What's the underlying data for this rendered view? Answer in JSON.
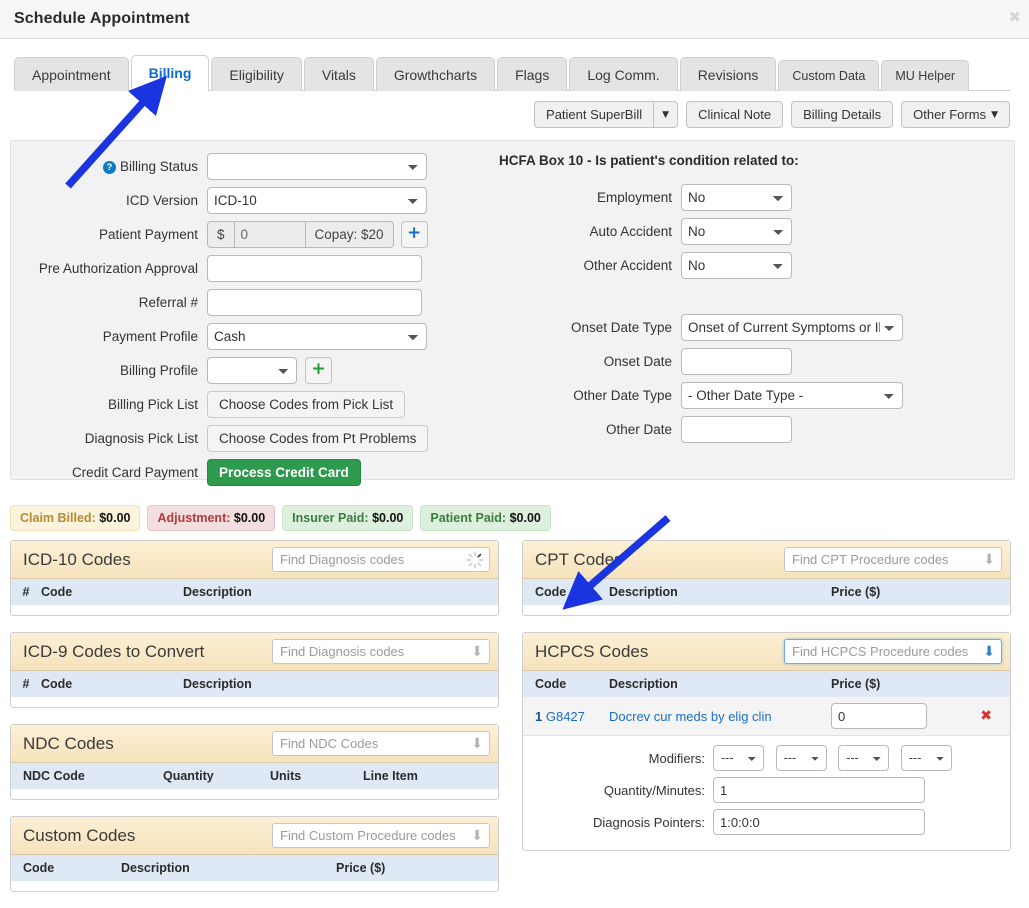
{
  "window": {
    "title": "Schedule Appointment",
    "close_icon": "close-icon"
  },
  "tabs": [
    {
      "label": "Appointment",
      "active": false
    },
    {
      "label": "Billing",
      "active": true
    },
    {
      "label": "Eligibility",
      "active": false
    },
    {
      "label": "Vitals",
      "active": false
    },
    {
      "label": "Growthcharts",
      "active": false
    },
    {
      "label": "Flags",
      "active": false
    },
    {
      "label": "Log Comm.",
      "active": false
    },
    {
      "label": "Revisions",
      "active": false
    },
    {
      "label": "Custom Data",
      "active": false
    },
    {
      "label": "MU Helper",
      "active": false
    }
  ],
  "toolbar": {
    "superbill": "Patient SuperBill",
    "superbill_caret": "▼",
    "clinical_note": "Clinical Note",
    "billing_details": "Billing Details",
    "other_forms": "Other Forms",
    "other_forms_caret": "▼"
  },
  "form_left": {
    "billing_status": {
      "label": "Billing Status",
      "value": "",
      "help": "?"
    },
    "icd_version": {
      "label": "ICD Version",
      "value": "ICD-10"
    },
    "patient_payment": {
      "label": "Patient Payment",
      "currency": "$",
      "value": "0",
      "copay": "Copay: $20",
      "add": "+"
    },
    "pre_auth": {
      "label": "Pre Authorization Approval",
      "value": ""
    },
    "referral": {
      "label": "Referral #",
      "value": ""
    },
    "payment_profile": {
      "label": "Payment Profile",
      "value": "Cash"
    },
    "billing_profile": {
      "label": "Billing Profile",
      "value": "",
      "add": "+"
    },
    "billing_pick_list": {
      "label": "Billing Pick List",
      "button": "Choose Codes from Pick List"
    },
    "diagnosis_pick_list": {
      "label": "Diagnosis Pick List",
      "button": "Choose Codes from Pt Problems"
    },
    "credit_card": {
      "label": "Credit Card Payment",
      "button": "Process Credit Card"
    }
  },
  "form_right": {
    "heading": "HCFA Box 10 - Is patient's condition related to:",
    "employment": {
      "label": "Employment",
      "value": "No"
    },
    "auto_accident": {
      "label": "Auto Accident",
      "value": "No"
    },
    "other_accident": {
      "label": "Other Accident",
      "value": "No"
    },
    "onset_date_type": {
      "label": "Onset Date Type",
      "value": "Onset of Current Symptoms or Illness"
    },
    "onset_date": {
      "label": "Onset Date",
      "value": ""
    },
    "other_date_type": {
      "label": "Other Date Type",
      "value": "- Other Date Type -"
    },
    "other_date": {
      "label": "Other Date",
      "value": ""
    }
  },
  "badges": [
    {
      "label": "Claim Billed:",
      "amount": "$0.00",
      "style": "warn"
    },
    {
      "label": "Adjustment:",
      "amount": "$0.00",
      "style": "danger"
    },
    {
      "label": "Insurer Paid:",
      "amount": "$0.00",
      "style": "ok"
    },
    {
      "label": "Patient Paid:",
      "amount": "$0.00",
      "style": "ok"
    }
  ],
  "panels": {
    "icd10": {
      "title": "ICD-10 Codes",
      "search_placeholder": "Find Diagnosis codes",
      "search_icon": "spinner-icon",
      "columns": [
        "#",
        "Code",
        "Description"
      ],
      "rows": []
    },
    "icd9": {
      "title": "ICD-9 Codes to Convert",
      "search_placeholder": "Find Diagnosis codes",
      "search_icon": "download-arrow-icon",
      "columns": [
        "#",
        "Code",
        "Description"
      ],
      "rows": []
    },
    "ndc": {
      "title": "NDC Codes",
      "search_placeholder": "Find NDC Codes",
      "search_icon": "download-arrow-icon",
      "columns": [
        "NDC Code",
        "Quantity",
        "Units",
        "Line Item"
      ],
      "rows": []
    },
    "custom": {
      "title": "Custom Codes",
      "search_placeholder": "Find Custom Procedure codes",
      "search_icon": "download-arrow-icon",
      "columns": [
        "Code",
        "Description",
        "Price ($)"
      ],
      "rows": []
    },
    "cpt": {
      "title": "CPT Codes",
      "search_placeholder": "Find CPT Procedure codes",
      "search_icon": "download-arrow-icon",
      "columns": [
        "Code",
        "Description",
        "Price ($)"
      ],
      "rows": []
    },
    "hcpcs": {
      "title": "HCPCS Codes",
      "search_placeholder": "Find HCPCS Procedure codes",
      "search_icon": "download-arrow-icon",
      "search_focused": true,
      "columns": [
        "Code",
        "Description",
        "Price ($)"
      ],
      "row": {
        "num": "1",
        "code": "G8427",
        "description": "Docrev cur meds by elig clin",
        "price": "0",
        "delete_icon": "✖"
      },
      "detail": {
        "modifiers_label": "Modifiers:",
        "modifiers": [
          "---",
          "---",
          "---",
          "---"
        ],
        "quantity_label": "Quantity/Minutes:",
        "quantity": "1",
        "pointers_label": "Diagnosis Pointers:",
        "pointers": "1:0:0:0"
      }
    }
  },
  "annotations": {
    "accent_color": "#1a35e0",
    "arrow_1_target": "Billing tab",
    "arrow_2_target": "HCPCS Codes panel"
  }
}
